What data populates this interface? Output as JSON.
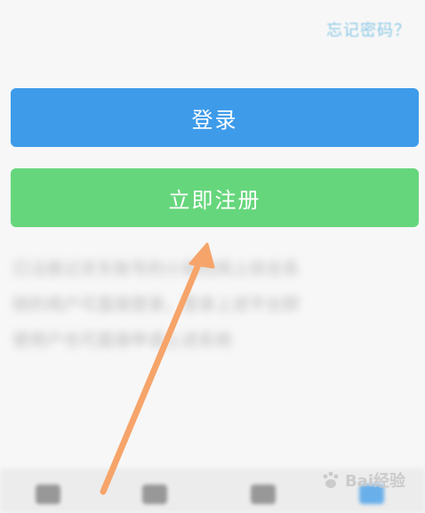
{
  "header": {
    "forgot_password": "忘记密码？"
  },
  "buttons": {
    "login_label": "登录",
    "register_label": "立即注册"
  },
  "notice": {
    "lines": [
      "已注册过京东账号的小保险网上综合系",
      "统的用户可直接登录，登录上述平台即",
      "使用户也可直接申请上述系统"
    ]
  },
  "watermark": {
    "text": "Bai经验"
  },
  "colors": {
    "login_button": "#3e9bea",
    "register_button": "#66d67c",
    "arrow": "#f6a46a",
    "link": "#8ecae6"
  }
}
